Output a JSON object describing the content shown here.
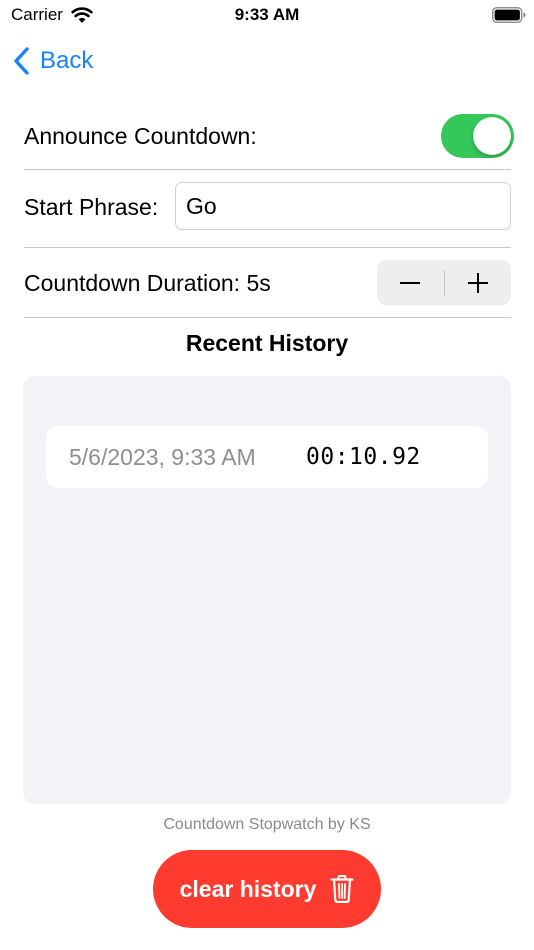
{
  "status_bar": {
    "carrier": "Carrier",
    "time": "9:33 AM"
  },
  "nav": {
    "back_label": "Back"
  },
  "settings": {
    "announce_label": "Announce Countdown:",
    "announce_enabled": true,
    "start_phrase_label": "Start Phrase:",
    "start_phrase_value": "Go",
    "duration_label": "Countdown Duration: 5s"
  },
  "history": {
    "title": "Recent History",
    "items": [
      {
        "date": "5/6/2023, 9:33 AM",
        "elapsed": "00:10.92"
      }
    ]
  },
  "footer": {
    "credit": "Countdown Stopwatch by KS",
    "clear_label": "clear history"
  },
  "colors": {
    "accent_blue": "#1a82f7",
    "toggle_green": "#34c759",
    "destructive_red": "#ff3b30",
    "panel_gray": "#f2f2f7"
  },
  "icons": [
    "wifi-icon",
    "battery-icon",
    "chevron-left-icon",
    "minus-icon",
    "plus-icon",
    "trash-icon"
  ]
}
